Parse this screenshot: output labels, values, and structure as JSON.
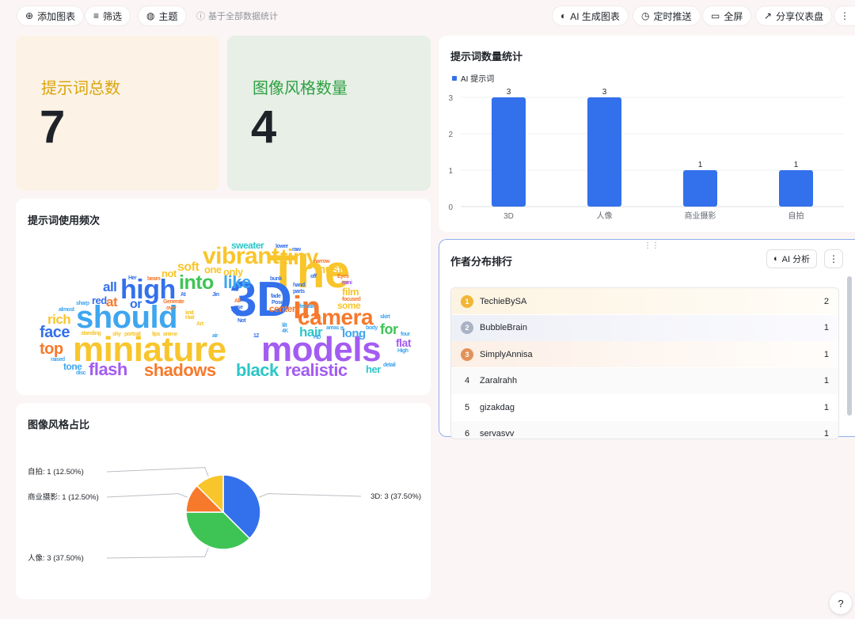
{
  "toolbar": {
    "add_chart": "添加图表",
    "filter": "筛选",
    "theme": "主题",
    "note": "基于全部数据统计",
    "ai_chart": "AI 生成图表",
    "schedule": "定时推送",
    "fullscreen": "全屏",
    "share": "分享仪表盘"
  },
  "kpis": [
    {
      "label": "提示词总数",
      "value": "7",
      "color": "#d9a50b",
      "bg": "#fcf2e6"
    },
    {
      "label": "图像风格数量",
      "value": "4",
      "color": "#2ea043",
      "bg": "#e7efe6"
    }
  ],
  "bar_card": {
    "title": "提示词数量统计"
  },
  "wordcloud_card": {
    "title": "提示词使用频次",
    "words": [
      "The",
      "3D",
      "in",
      "miniature",
      "models",
      "should",
      "high",
      "vibrant",
      "tiny",
      "camera",
      "flash",
      "shadows",
      "black",
      "realistic",
      "into",
      "like",
      "face",
      "rich",
      "top",
      "hair",
      "for",
      "long",
      "flat",
      "her",
      "tone",
      "all",
      "at",
      "or",
      "red",
      "soft",
      "one",
      "only",
      "not",
      "must",
      "sweater",
      "film",
      "some",
      "center",
      "lower",
      "raw",
      "narrow",
      "Eyes",
      "mini",
      "focused",
      "fade",
      "bunk",
      "Pose",
      "hand",
      "parts",
      "off",
      "female",
      "skirt",
      "four",
      "detail",
      "High",
      "body",
      "areas",
      "lips",
      "anime",
      "portrait",
      "shy",
      "standing",
      "sharp",
      "almost",
      "raised",
      "disc",
      "Generate",
      "over",
      "Her",
      "beam",
      "At",
      "Jin",
      "knit",
      "Hair",
      "Art",
      "All",
      "use",
      "fall",
      "Not",
      "lilt",
      "4K",
      "HD",
      "12",
      "air",
      "lit",
      "tt"
    ]
  },
  "pie_card": {
    "title": "图像风格占比"
  },
  "rank_card": {
    "title": "作者分布排行",
    "ai_button": "AI 分析",
    "rows": [
      {
        "rank": "1",
        "name": "TechieBySA",
        "count": "2"
      },
      {
        "rank": "2",
        "name": "BubbleBrain",
        "count": "1"
      },
      {
        "rank": "3",
        "name": "SimplyAnnisa",
        "count": "1"
      },
      {
        "rank": "4",
        "name": "Zaralrahh",
        "count": "1"
      },
      {
        "rank": "5",
        "name": "gizakdag",
        "count": "1"
      },
      {
        "rank": "6",
        "name": "servasvv",
        "count": "1"
      }
    ]
  },
  "help": "?",
  "chart_data": [
    {
      "type": "bar",
      "title": "提示词数量统计",
      "categories": [
        "3D",
        "人像",
        "商业摄影",
        "自拍"
      ],
      "series": [
        {
          "name": "AI 提示词",
          "values": [
            3,
            3,
            1,
            1
          ],
          "color": "#3370eb"
        }
      ],
      "ylim": [
        0,
        3
      ],
      "yticks": [
        0,
        1,
        2,
        3
      ],
      "legend": "top-left",
      "grid": true
    },
    {
      "type": "pie",
      "title": "图像风格占比",
      "slices": [
        {
          "label": "3D",
          "value": 3,
          "percent": "37.50%",
          "text": "3D: 3 (37.50%)",
          "color": "#3370eb"
        },
        {
          "label": "人像",
          "value": 3,
          "percent": "37.50%",
          "text": "人像: 3 (37.50%)",
          "color": "#3ec454"
        },
        {
          "label": "商业摄影",
          "value": 1,
          "percent": "12.50%",
          "text": "商业摄影: 1 (12.50%)",
          "color": "#f7792c"
        },
        {
          "label": "自拍",
          "value": 1,
          "percent": "12.50%",
          "text": "自拍: 1 (12.50%)",
          "color": "#f8c52b"
        }
      ]
    }
  ]
}
